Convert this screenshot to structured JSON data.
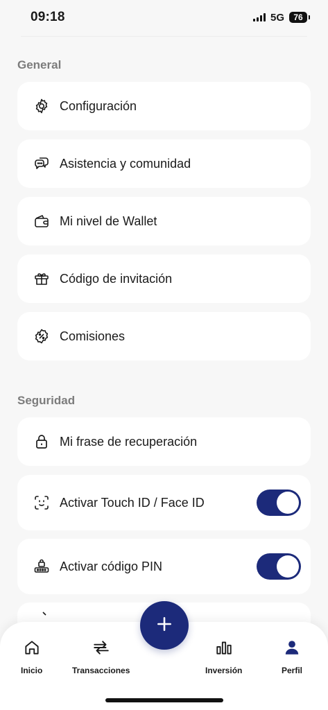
{
  "status_bar": {
    "time": "09:18",
    "network": "5G",
    "battery": "76"
  },
  "sections": {
    "general": {
      "title": "General",
      "items": [
        {
          "label": "Configuración",
          "icon": "gear-icon"
        },
        {
          "label": "Asistencia y comunidad",
          "icon": "chat-bubbles-icon"
        },
        {
          "label": "Mi nivel de Wallet",
          "icon": "wallet-icon"
        },
        {
          "label": "Código de invitación",
          "icon": "gift-icon"
        },
        {
          "label": "Comisiones",
          "icon": "percent-badge-icon"
        }
      ]
    },
    "security": {
      "title": "Seguridad",
      "items": [
        {
          "label": "Mi frase de recuperación",
          "icon": "lock-icon"
        },
        {
          "label": "Activar Touch ID / Face ID",
          "icon": "face-id-icon",
          "toggle": true
        },
        {
          "label": "Activar código PIN",
          "icon": "pin-lock-icon",
          "toggle": true
        }
      ]
    }
  },
  "bottom_nav": {
    "items": [
      {
        "label": "Inicio",
        "icon": "home-icon"
      },
      {
        "label": "Transacciones",
        "icon": "transfer-arrows-icon"
      },
      {
        "label": "Inversión",
        "icon": "bar-chart-icon"
      },
      {
        "label": "Perfil",
        "icon": "profile-icon"
      }
    ],
    "fab_icon": "plus-icon"
  },
  "colors": {
    "accent": "#1c2a7a",
    "background": "#f7f7f7",
    "card": "#ffffff",
    "section_title": "#7c7c7c"
  }
}
